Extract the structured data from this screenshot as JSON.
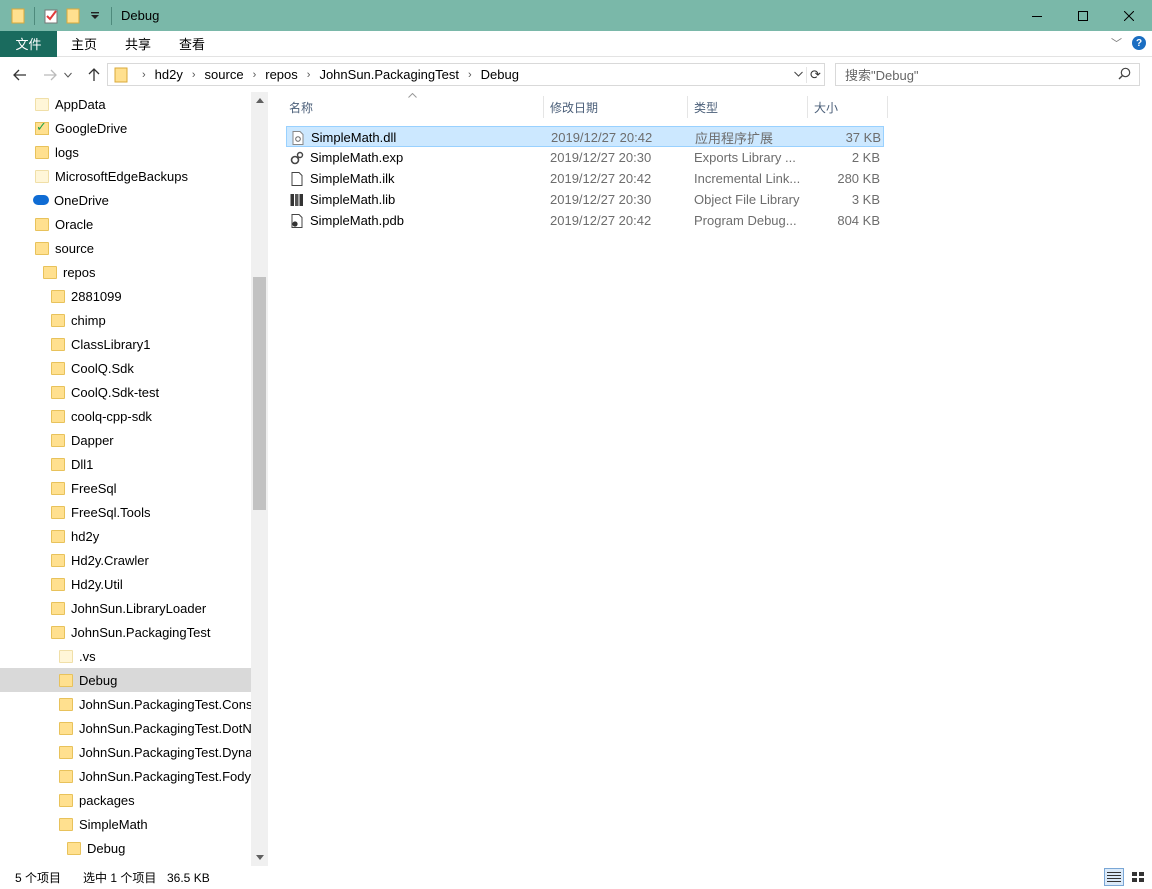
{
  "window": {
    "title": "Debug"
  },
  "ribbon": {
    "tabs": [
      "文件",
      "主页",
      "共享",
      "查看"
    ]
  },
  "address": {
    "crumbs": [
      "hd2y",
      "source",
      "repos",
      "JohnSun.PackagingTest",
      "Debug"
    ]
  },
  "search": {
    "placeholder": "搜索\"Debug\""
  },
  "tree": {
    "items": [
      {
        "label": "AppData",
        "icon": "folder-light-icon"
      },
      {
        "label": "GoogleDrive",
        "icon": "google-drive-folder-icon"
      },
      {
        "label": "logs",
        "icon": "folder-icon"
      },
      {
        "label": "MicrosoftEdgeBackups",
        "icon": "folder-light-icon"
      },
      {
        "label": "OneDrive",
        "icon": "onedrive-cloud-icon"
      },
      {
        "label": "Oracle",
        "icon": "folder-icon"
      },
      {
        "label": "source",
        "icon": "folder-icon"
      },
      {
        "label": "repos",
        "icon": "folder-icon"
      },
      {
        "label": "2881099",
        "icon": "folder-icon"
      },
      {
        "label": "chimp",
        "icon": "folder-icon"
      },
      {
        "label": "ClassLibrary1",
        "icon": "folder-icon"
      },
      {
        "label": "CoolQ.Sdk",
        "icon": "folder-icon"
      },
      {
        "label": "CoolQ.Sdk-test",
        "icon": "folder-icon"
      },
      {
        "label": "coolq-cpp-sdk",
        "icon": "folder-icon"
      },
      {
        "label": "Dapper",
        "icon": "folder-icon"
      },
      {
        "label": "Dll1",
        "icon": "folder-icon"
      },
      {
        "label": "FreeSql",
        "icon": "folder-icon"
      },
      {
        "label": "FreeSql.Tools",
        "icon": "folder-icon"
      },
      {
        "label": "hd2y",
        "icon": "folder-icon"
      },
      {
        "label": "Hd2y.Crawler",
        "icon": "folder-icon"
      },
      {
        "label": "Hd2y.Util",
        "icon": "folder-icon"
      },
      {
        "label": "JohnSun.LibraryLoader",
        "icon": "folder-icon"
      },
      {
        "label": "JohnSun.PackagingTest",
        "icon": "folder-icon"
      },
      {
        "label": ".vs",
        "icon": "folder-light-icon"
      },
      {
        "label": "Debug",
        "icon": "folder-icon",
        "selected": true
      },
      {
        "label": "JohnSun.PackagingTest.Console",
        "icon": "folder-icon"
      },
      {
        "label": "JohnSun.PackagingTest.DotNet",
        "icon": "folder-icon"
      },
      {
        "label": "JohnSun.PackagingTest.Dynamic",
        "icon": "folder-icon"
      },
      {
        "label": "JohnSun.PackagingTest.FodyCosturaCompress",
        "icon": "folder-icon"
      },
      {
        "label": "packages",
        "icon": "folder-icon"
      },
      {
        "label": "SimpleMath",
        "icon": "folder-icon"
      },
      {
        "label": "Debug",
        "icon": "folder-icon"
      }
    ]
  },
  "columns": {
    "name": "名称",
    "date": "修改日期",
    "type": "类型",
    "size": "大小"
  },
  "files": [
    {
      "name": "SimpleMath.dll",
      "date": "2019/12/27 20:42",
      "type": "应用程序扩展",
      "size": "37 KB",
      "icon": "dll-file-icon",
      "selected": true
    },
    {
      "name": "SimpleMath.exp",
      "date": "2019/12/27 20:30",
      "type": "Exports Library ...",
      "size": "2 KB",
      "icon": "exp-file-icon"
    },
    {
      "name": "SimpleMath.ilk",
      "date": "2019/12/27 20:42",
      "type": "Incremental Link...",
      "size": "280 KB",
      "icon": "ilk-file-icon"
    },
    {
      "name": "SimpleMath.lib",
      "date": "2019/12/27 20:30",
      "type": "Object File Library",
      "size": "3 KB",
      "icon": "lib-file-icon"
    },
    {
      "name": "SimpleMath.pdb",
      "date": "2019/12/27 20:42",
      "type": "Program Debug...",
      "size": "804 KB",
      "icon": "pdb-file-icon"
    }
  ],
  "status": {
    "count": "5 个项目",
    "selection": "选中 1 个项目",
    "size": "36.5 KB"
  }
}
